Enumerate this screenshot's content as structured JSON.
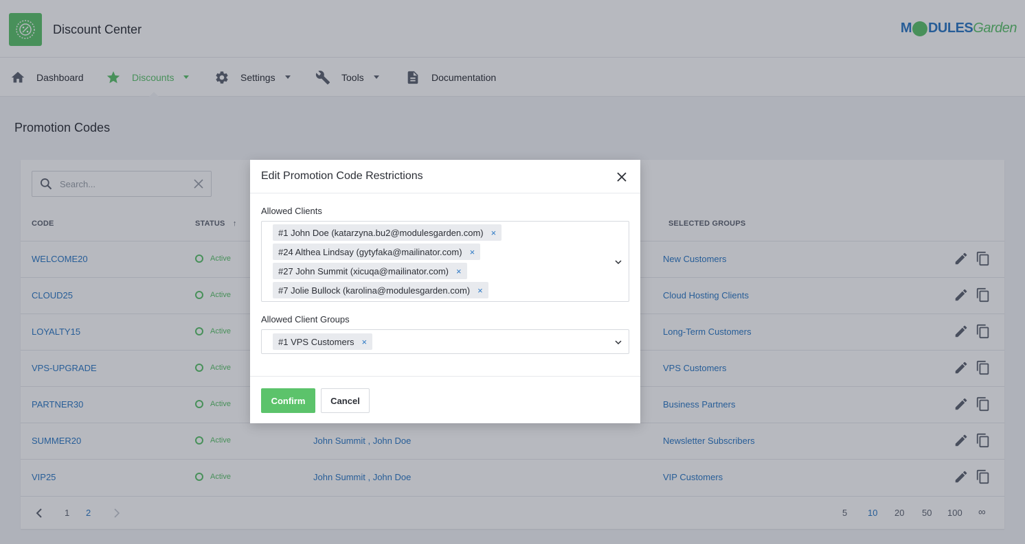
{
  "app": {
    "title": "Discount Center",
    "brand_main": "DULES",
    "brand_prefix": "M",
    "brand_suffix": "Garden"
  },
  "nav": {
    "dashboard": "Dashboard",
    "discounts": "Discounts",
    "settings": "Settings",
    "tools": "Tools",
    "documentation": "Documentation"
  },
  "page": {
    "title": "Promotion Codes"
  },
  "search": {
    "placeholder": "Search..."
  },
  "table": {
    "headers": {
      "code": "CODE",
      "status": "STATUS",
      "status_sort": "↑",
      "groups": "SELECTED GROUPS"
    },
    "rows": [
      {
        "code": "WELCOME20",
        "status": "Active",
        "clients": "",
        "groups": "New Customers"
      },
      {
        "code": "CLOUD25",
        "status": "Active",
        "clients": "",
        "groups": "Cloud Hosting Clients"
      },
      {
        "code": "LOYALTY15",
        "status": "Active",
        "clients": "",
        "groups": "Long-Term Customers"
      },
      {
        "code": "VPS-UPGRADE",
        "status": "Active",
        "clients": "",
        "groups": "VPS Customers"
      },
      {
        "code": "PARTNER30",
        "status": "Active",
        "clients": "",
        "groups": "Business Partners"
      },
      {
        "code": "SUMMER20",
        "status": "Active",
        "clients": "John Summit , John Doe",
        "groups": "Newsletter Subscribers"
      },
      {
        "code": "VIP25",
        "status": "Active",
        "clients": "John Summit , John Doe",
        "groups": "VIP Customers"
      }
    ]
  },
  "pagination": {
    "pages": [
      "1",
      "2"
    ],
    "current_page": "2",
    "page_sizes": [
      "5",
      "10",
      "20",
      "50",
      "100",
      "∞"
    ],
    "current_size": "10"
  },
  "modal": {
    "title": "Edit Promotion Code Restrictions",
    "allowed_clients_label": "Allowed Clients",
    "allowed_clients": [
      "#1 John Doe (katarzyna.bu2@modulesgarden.com)",
      "#24 Althea Lindsay (gytyfaka@mailinator.com)",
      "#27 John Summit (xicuqa@mailinator.com)",
      "#7 Jolie Bullock (karolina@modulesgarden.com)"
    ],
    "allowed_groups_label": "Allowed Client Groups",
    "allowed_groups": [
      "#1 VPS Customers"
    ],
    "remove_symbol": "×",
    "confirm_label": "Confirm",
    "cancel_label": "Cancel"
  },
  "colors": {
    "accent": "#5cc36b",
    "link": "#2b78c5",
    "overlay": "rgba(30,38,56,0.32)"
  }
}
